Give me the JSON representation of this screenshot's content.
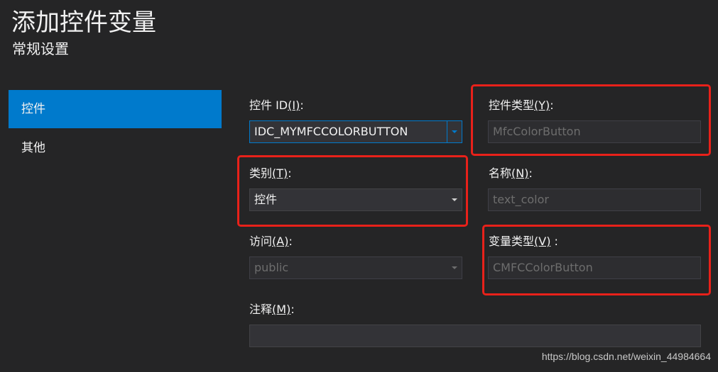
{
  "header": {
    "title": "添加控件变量",
    "subtitle": "常规设置"
  },
  "sidebar": {
    "items": [
      {
        "label": "控件",
        "active": true
      },
      {
        "label": "其他",
        "active": false
      }
    ]
  },
  "form": {
    "control_id": {
      "label": "控件 ID",
      "mnemonic": "(I)",
      "suffix": ":",
      "value": "IDC_MYMFCCOLORBUTTON"
    },
    "control_type": {
      "label": "控件类型",
      "mnemonic": "(Y)",
      "suffix": ":",
      "value": "MfcColorButton"
    },
    "category": {
      "label": "类别",
      "mnemonic": "(T)",
      "suffix": ":",
      "value": "控件"
    },
    "name": {
      "label": "名称",
      "mnemonic": "(N)",
      "suffix": ":",
      "value": "text_color"
    },
    "access": {
      "label": "访问",
      "mnemonic": "(A)",
      "suffix": ":",
      "value": "public"
    },
    "variable_type": {
      "label": "变量类型",
      "mnemonic": "(V)",
      "suffix": " :",
      "value": "CMFCColorButton"
    },
    "comment": {
      "label": "注释",
      "mnemonic": "(M)",
      "suffix": ":",
      "value": ""
    }
  },
  "colors": {
    "background": "#252526",
    "accent": "#007acc",
    "highlight": "#e8211a"
  },
  "watermark": "https://blog.csdn.net/weixin_44984664"
}
